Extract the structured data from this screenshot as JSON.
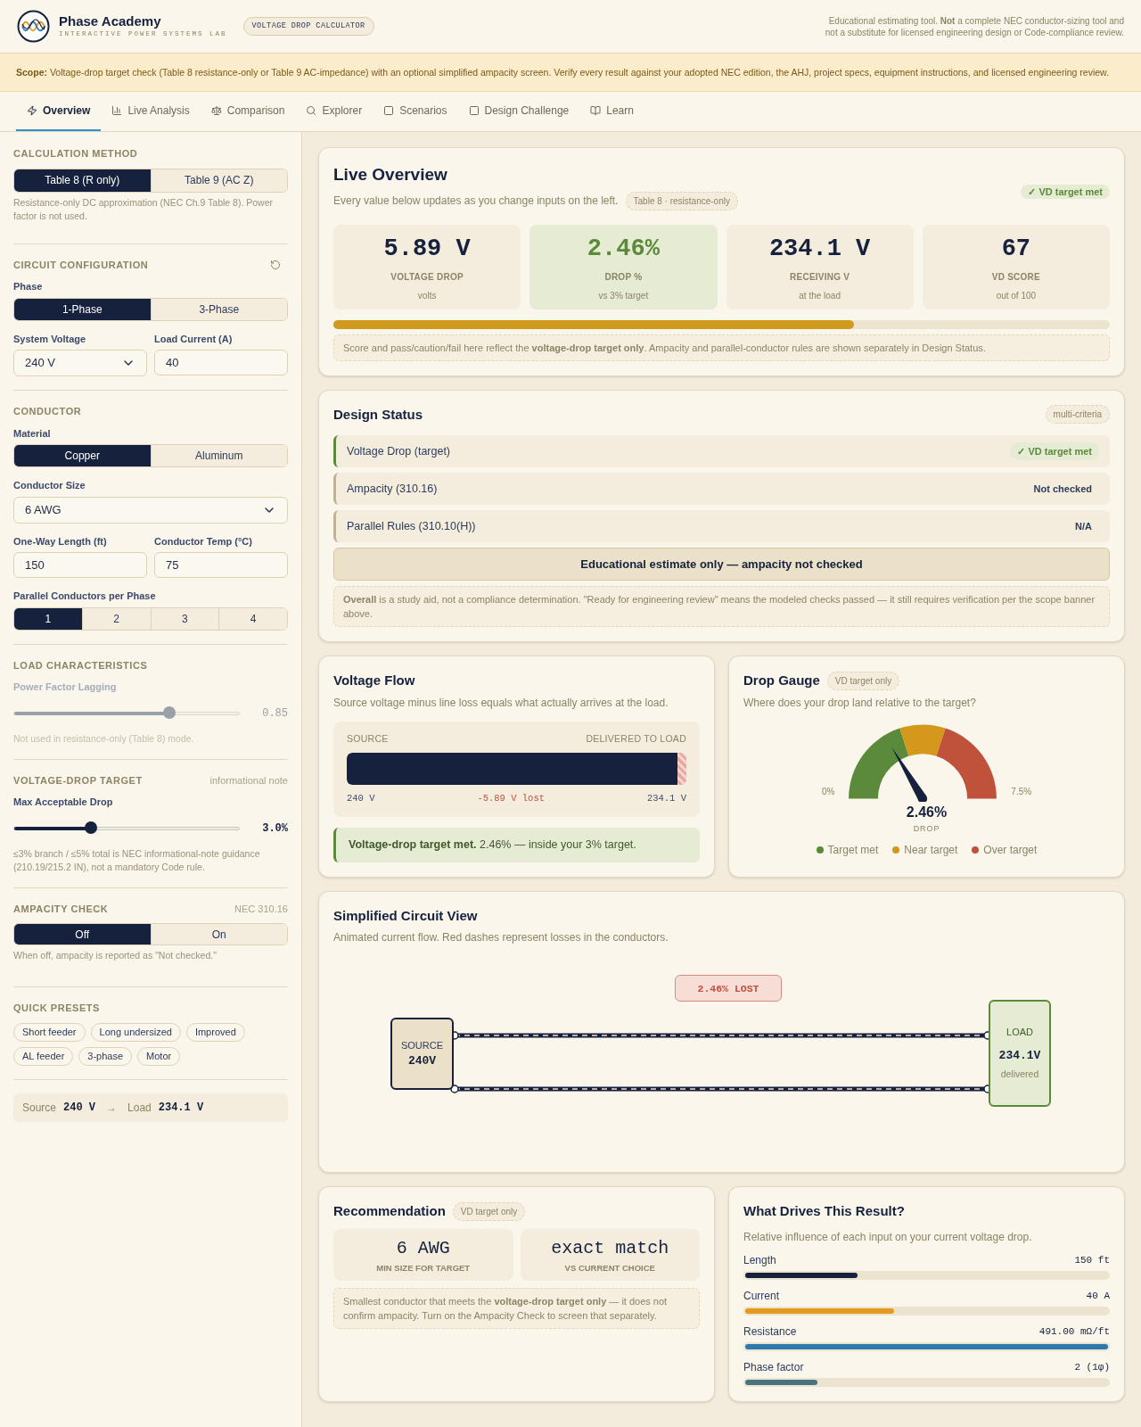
{
  "header": {
    "brand": "Phase Academy",
    "tagline": "INTERACTIVE POWER SYSTEMS LAB",
    "badge": "VOLTAGE DROP CALCULATOR",
    "disclaimer": "Educational estimating tool. **Not** a complete NEC conductor-sizing tool and not a substitute for licensed engineering design or Code-compliance review."
  },
  "scope": "**Scope:** Voltage-drop target check (Table 8 resistance-only or Table 9 AC-impedance) with an optional simplified ampacity screen. Verify every result against your adopted NEC edition, the AHJ, project specs, equipment instructions, and licensed engineering review.",
  "tabs": [
    {
      "label": "Overview",
      "selected": true
    },
    {
      "label": "Live Analysis",
      "selected": false
    },
    {
      "label": "Comparison",
      "selected": false
    },
    {
      "label": "Explorer",
      "selected": false
    },
    {
      "label": "Scenarios",
      "selected": false
    },
    {
      "label": "Design Challenge",
      "selected": false
    },
    {
      "label": "Learn",
      "selected": false
    }
  ],
  "sidebar": {
    "method": {
      "heading": "CALCULATION METHOD",
      "options": [
        {
          "label": "Table 8 (R only)",
          "selected": true
        },
        {
          "label": "Table 9 (AC Z)",
          "selected": false
        }
      ],
      "note": "Resistance-only DC approximation (NEC Ch.9 Table 8). Power factor is not used."
    },
    "circuit": {
      "heading": "CIRCUIT CONFIGURATION",
      "phase": {
        "label": "Phase",
        "options": [
          {
            "label": "1-Phase",
            "selected": true
          },
          {
            "label": "3-Phase",
            "selected": false
          }
        ]
      },
      "voltage": {
        "label": "System Voltage",
        "value": "240 V"
      },
      "current": {
        "label": "Load Current (A)",
        "value": "40"
      }
    },
    "conductor": {
      "heading": "CONDUCTOR",
      "material": {
        "label": "Material",
        "options": [
          {
            "label": "Copper",
            "selected": true
          },
          {
            "label": "Aluminum",
            "selected": false
          }
        ]
      },
      "size": {
        "label": "Conductor Size",
        "value": "6 AWG"
      },
      "length": {
        "label": "One-Way Length (ft)",
        "value": "150"
      },
      "temp": {
        "label": "Conductor Temp (°C)",
        "value": "75"
      },
      "parallel": {
        "label": "Parallel Conductors per Phase",
        "options": [
          {
            "label": "1",
            "selected": true
          },
          {
            "label": "2",
            "selected": false
          },
          {
            "label": "3",
            "selected": false
          },
          {
            "label": "4",
            "selected": false
          }
        ]
      }
    },
    "load": {
      "heading": "LOAD CHARACTERISTICS",
      "slider": {
        "label": "Power Factor Lagging",
        "level": 0.69,
        "reading": "0.85",
        "disabled": true
      },
      "note": "Not used in resistance-only (Table 8) mode."
    },
    "target": {
      "heading": "VOLTAGE-DROP TARGET",
      "aside": "informational note",
      "slider": {
        "label": "Max Acceptable Drop",
        "level": 0.34,
        "reading": "3.0%",
        "disabled": false
      },
      "note": "≤3% branch / ≤5% total is NEC informational-note guidance (210.19/215.2 IN), not a mandatory Code rule."
    },
    "ampacity": {
      "heading": "AMPACITY CHECK",
      "aside": "NEC 310.16",
      "options": [
        {
          "label": "Off",
          "selected": true
        },
        {
          "label": "On",
          "selected": false
        }
      ],
      "note": "When off, ampacity is reported as \"Not checked.\""
    },
    "presets": {
      "heading": "QUICK PRESETS",
      "items": [
        "Short feeder",
        "Long undersized",
        "Improved",
        "AL feeder",
        "3-phase",
        "Motor"
      ]
    },
    "summary": {
      "source_label": "Source",
      "source_value": "240 V",
      "arrow": "→",
      "load_label": "Load",
      "load_value": "234.1 V"
    }
  },
  "overview": {
    "title": "Live Overview",
    "subtitle": "Every value below updates as you change inputs on the left.",
    "method_badge": "Table 8 · resistance-only",
    "status_badge": "✓ VD target met",
    "metrics": [
      {
        "value": "5.89 V",
        "label": "VOLTAGE DROP",
        "sub": "volts",
        "highlight": false
      },
      {
        "value": "2.46%",
        "label": "DROP %",
        "sub": "vs 3% target",
        "highlight": true
      },
      {
        "value": "234.1 V",
        "label": "RECEIVING V",
        "sub": "at the load",
        "highlight": false
      },
      {
        "value": "67",
        "label": "VD SCORE",
        "sub": "out of 100",
        "highlight": false
      }
    ],
    "score_bar": {
      "level": 0.67
    },
    "note": "Score and pass/caution/fail here reflect the **voltage-drop target only**. Ampacity and parallel-conductor rules are shown separately in Design Status."
  },
  "design_status": {
    "title": "Design Status",
    "badge": "multi-criteria",
    "checks": [
      {
        "label": "Voltage Drop (target)",
        "status": "✓ VD target met",
        "passed": true
      },
      {
        "label": "Ampacity (310.16)",
        "status": "Not checked",
        "passed": false
      },
      {
        "label": "Parallel Rules (310.10(H))",
        "status": "N/A",
        "passed": false
      }
    ],
    "verdict": "Educational estimate only — ampacity not checked",
    "note": "**Overall** is a study aid, not a compliance determination. \"Ready for engineering review\" means the modeled checks passed — it still requires verification per the scope banner above."
  },
  "voltage_flow": {
    "title": "Voltage Flow",
    "subtitle": "Source voltage minus line loss equals what actually arrives at the load.",
    "left_label": "SOURCE",
    "right_label": "DELIVERED TO LOAD",
    "level": 0.975,
    "source_reading": "240 V",
    "loss_reading": "-5.89 V lost",
    "load_reading": "234.1 V",
    "result": "**Voltage-drop target met.** 2.46% — inside your 3% target."
  },
  "drop_gauge": {
    "title": "Drop Gauge",
    "badge": "VD target only",
    "subtitle": "Where does your drop land relative to the target?",
    "min_label": "0%",
    "max_label": "7.5%",
    "reading": "2.46%",
    "reading_label": "DROP",
    "legend": [
      {
        "label": "Target met",
        "color": "#5a8a3a"
      },
      {
        "label": "Near target",
        "color": "#d4991c"
      },
      {
        "label": "Over target",
        "color": "#c0513a"
      }
    ]
  },
  "circuit": {
    "title": "Simplified Circuit View",
    "subtitle": "Animated current flow. Red dashes represent losses in the conductors.",
    "loss_label": "2.46% LOST",
    "source": {
      "label": "SOURCE",
      "value": "240V"
    },
    "load": {
      "label": "LOAD",
      "value": "234.1V",
      "sub": "delivered"
    }
  },
  "recommendation": {
    "title": "Recommendation",
    "badge": "VD target only",
    "tiles": [
      {
        "value": "6 AWG",
        "label": "MIN SIZE FOR TARGET"
      },
      {
        "value": "exact match",
        "label": "VS CURRENT CHOICE"
      }
    ],
    "note": "Smallest conductor that meets the **voltage-drop target only** — it does not confirm ampacity. Turn on the Ampacity Check to screen that separately."
  },
  "drivers": {
    "title": "What Drives This Result?",
    "subtitle": "Relative influence of each input on your current voltage drop.",
    "factors": [
      {
        "label": "Length",
        "reading": "150 ft",
        "level": 0.31,
        "color": "#15213d"
      },
      {
        "label": "Current",
        "reading": "40 A",
        "level": 0.41,
        "color": "#e39a1f"
      },
      {
        "label": "Resistance",
        "reading": "491.00 mΩ/ft",
        "level": 1.0,
        "color": "#2e79ad"
      },
      {
        "label": "Phase factor",
        "reading": "2 (1φ)",
        "level": 0.2,
        "color": "#4a7580"
      }
    ]
  }
}
